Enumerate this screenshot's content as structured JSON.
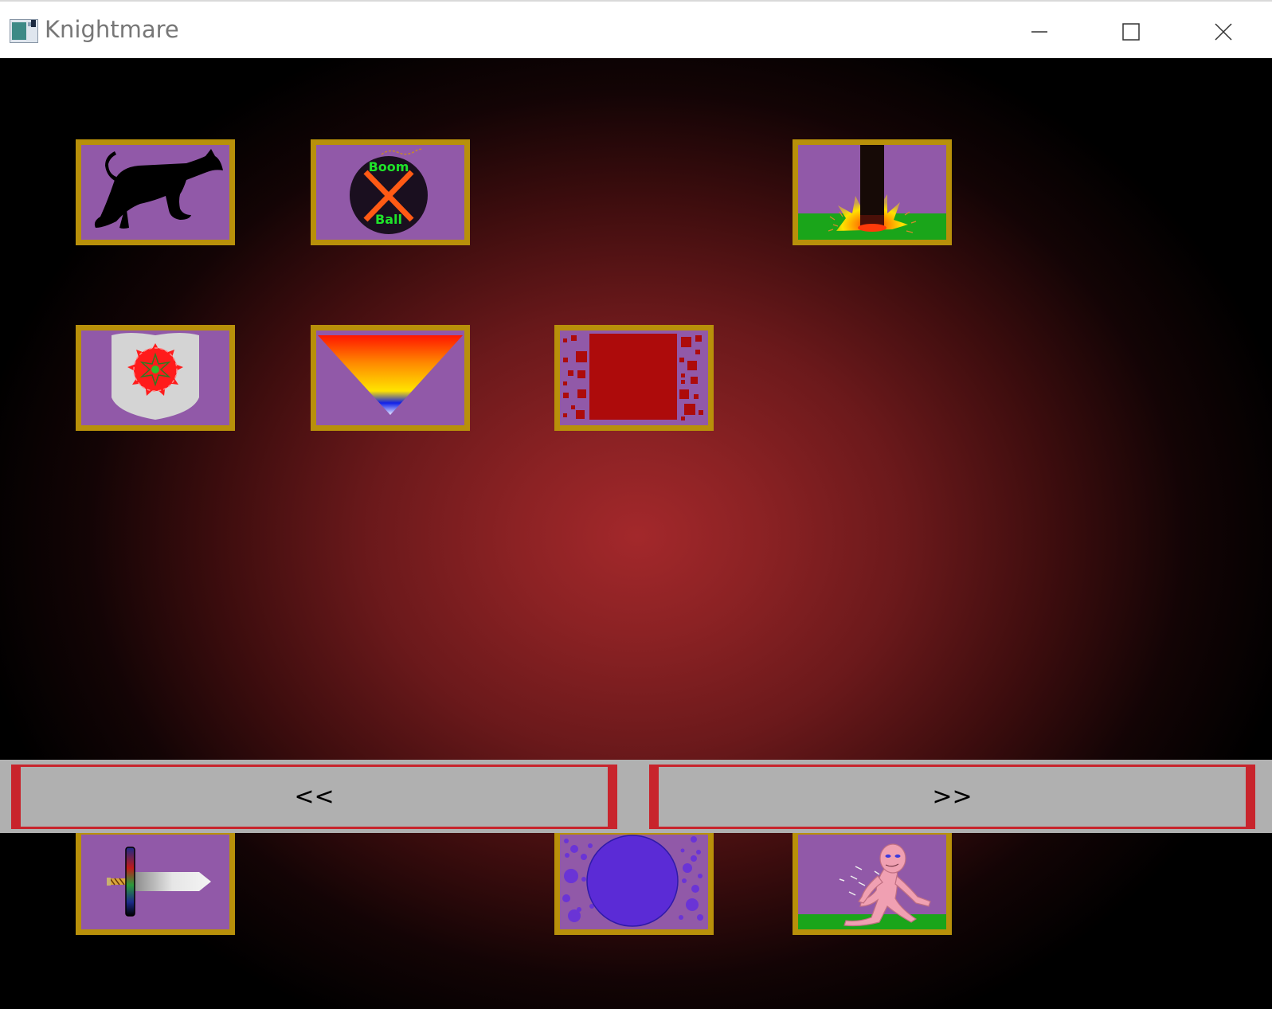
{
  "window": {
    "title": "Knightmare",
    "controls": {
      "minimize": "minimize-icon",
      "maximize": "maximize-icon",
      "close": "close-icon"
    }
  },
  "tiles": [
    {
      "id": "hound",
      "icon": "hound-icon"
    },
    {
      "id": "boom-ball",
      "icon": "bomb-icon",
      "label_top": "Boom",
      "label_bottom": "Ball"
    },
    {
      "id": "pillar-explosion",
      "icon": "explosion-icon"
    },
    {
      "id": "shield",
      "icon": "shield-icon"
    },
    {
      "id": "funnel",
      "icon": "funnel-icon"
    },
    {
      "id": "red-block",
      "icon": "red-square-icon"
    },
    {
      "id": "sword",
      "icon": "sword-icon"
    },
    {
      "id": "purple-orb",
      "icon": "orb-icon"
    },
    {
      "id": "pink-figure",
      "icon": "figure-icon"
    }
  ],
  "nav": {
    "prev_label": "<<",
    "next_label": ">>"
  },
  "colors": {
    "tile_border": "#b8900a",
    "tile_bg": "#9159a8",
    "nav_bar": "#b0b0b0",
    "nav_accent": "#c8242c",
    "ground": "#1aa51a"
  }
}
